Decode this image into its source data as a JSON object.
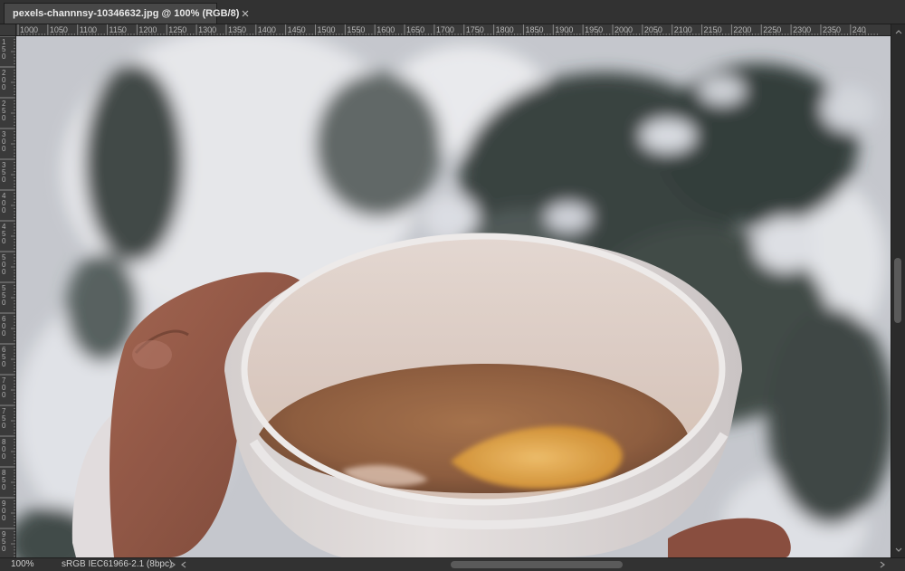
{
  "document": {
    "tab_title": "pexels-channnsy-10346632.jpg @ 100% (RGB/8)"
  },
  "rulers": {
    "horizontal_labels": [
      "1000",
      "1050",
      "1100",
      "1150",
      "1200",
      "1250",
      "1300",
      "1350",
      "1400",
      "1450",
      "1500",
      "1550",
      "1600",
      "1650",
      "1700",
      "1750",
      "1800",
      "1850",
      "1900",
      "1950",
      "2000",
      "2050",
      "2100",
      "2150",
      "2200",
      "2250",
      "2300",
      "2350",
      "240"
    ],
    "vertical_labels": [
      "150",
      "200",
      "250",
      "300",
      "350",
      "400",
      "450",
      "500",
      "550",
      "600",
      "650",
      "700",
      "750",
      "800",
      "850",
      "900",
      "950"
    ]
  },
  "status": {
    "zoom": "100%",
    "color_profile": "sRGB IEC61966-2.1 (8bpc)"
  },
  "icons": {
    "close": "close-icon",
    "scroll_up": "chevron-up-icon",
    "scroll_down": "chevron-down-icon",
    "status_menu": "chevron-right-icon",
    "scroll_left": "chevron-left-icon",
    "scroll_right": "chevron-right-icon"
  },
  "colors": {
    "app_background": "#282828",
    "panel": "#323232",
    "ruler": "#3a3a3a",
    "tab_active": "#484848"
  }
}
